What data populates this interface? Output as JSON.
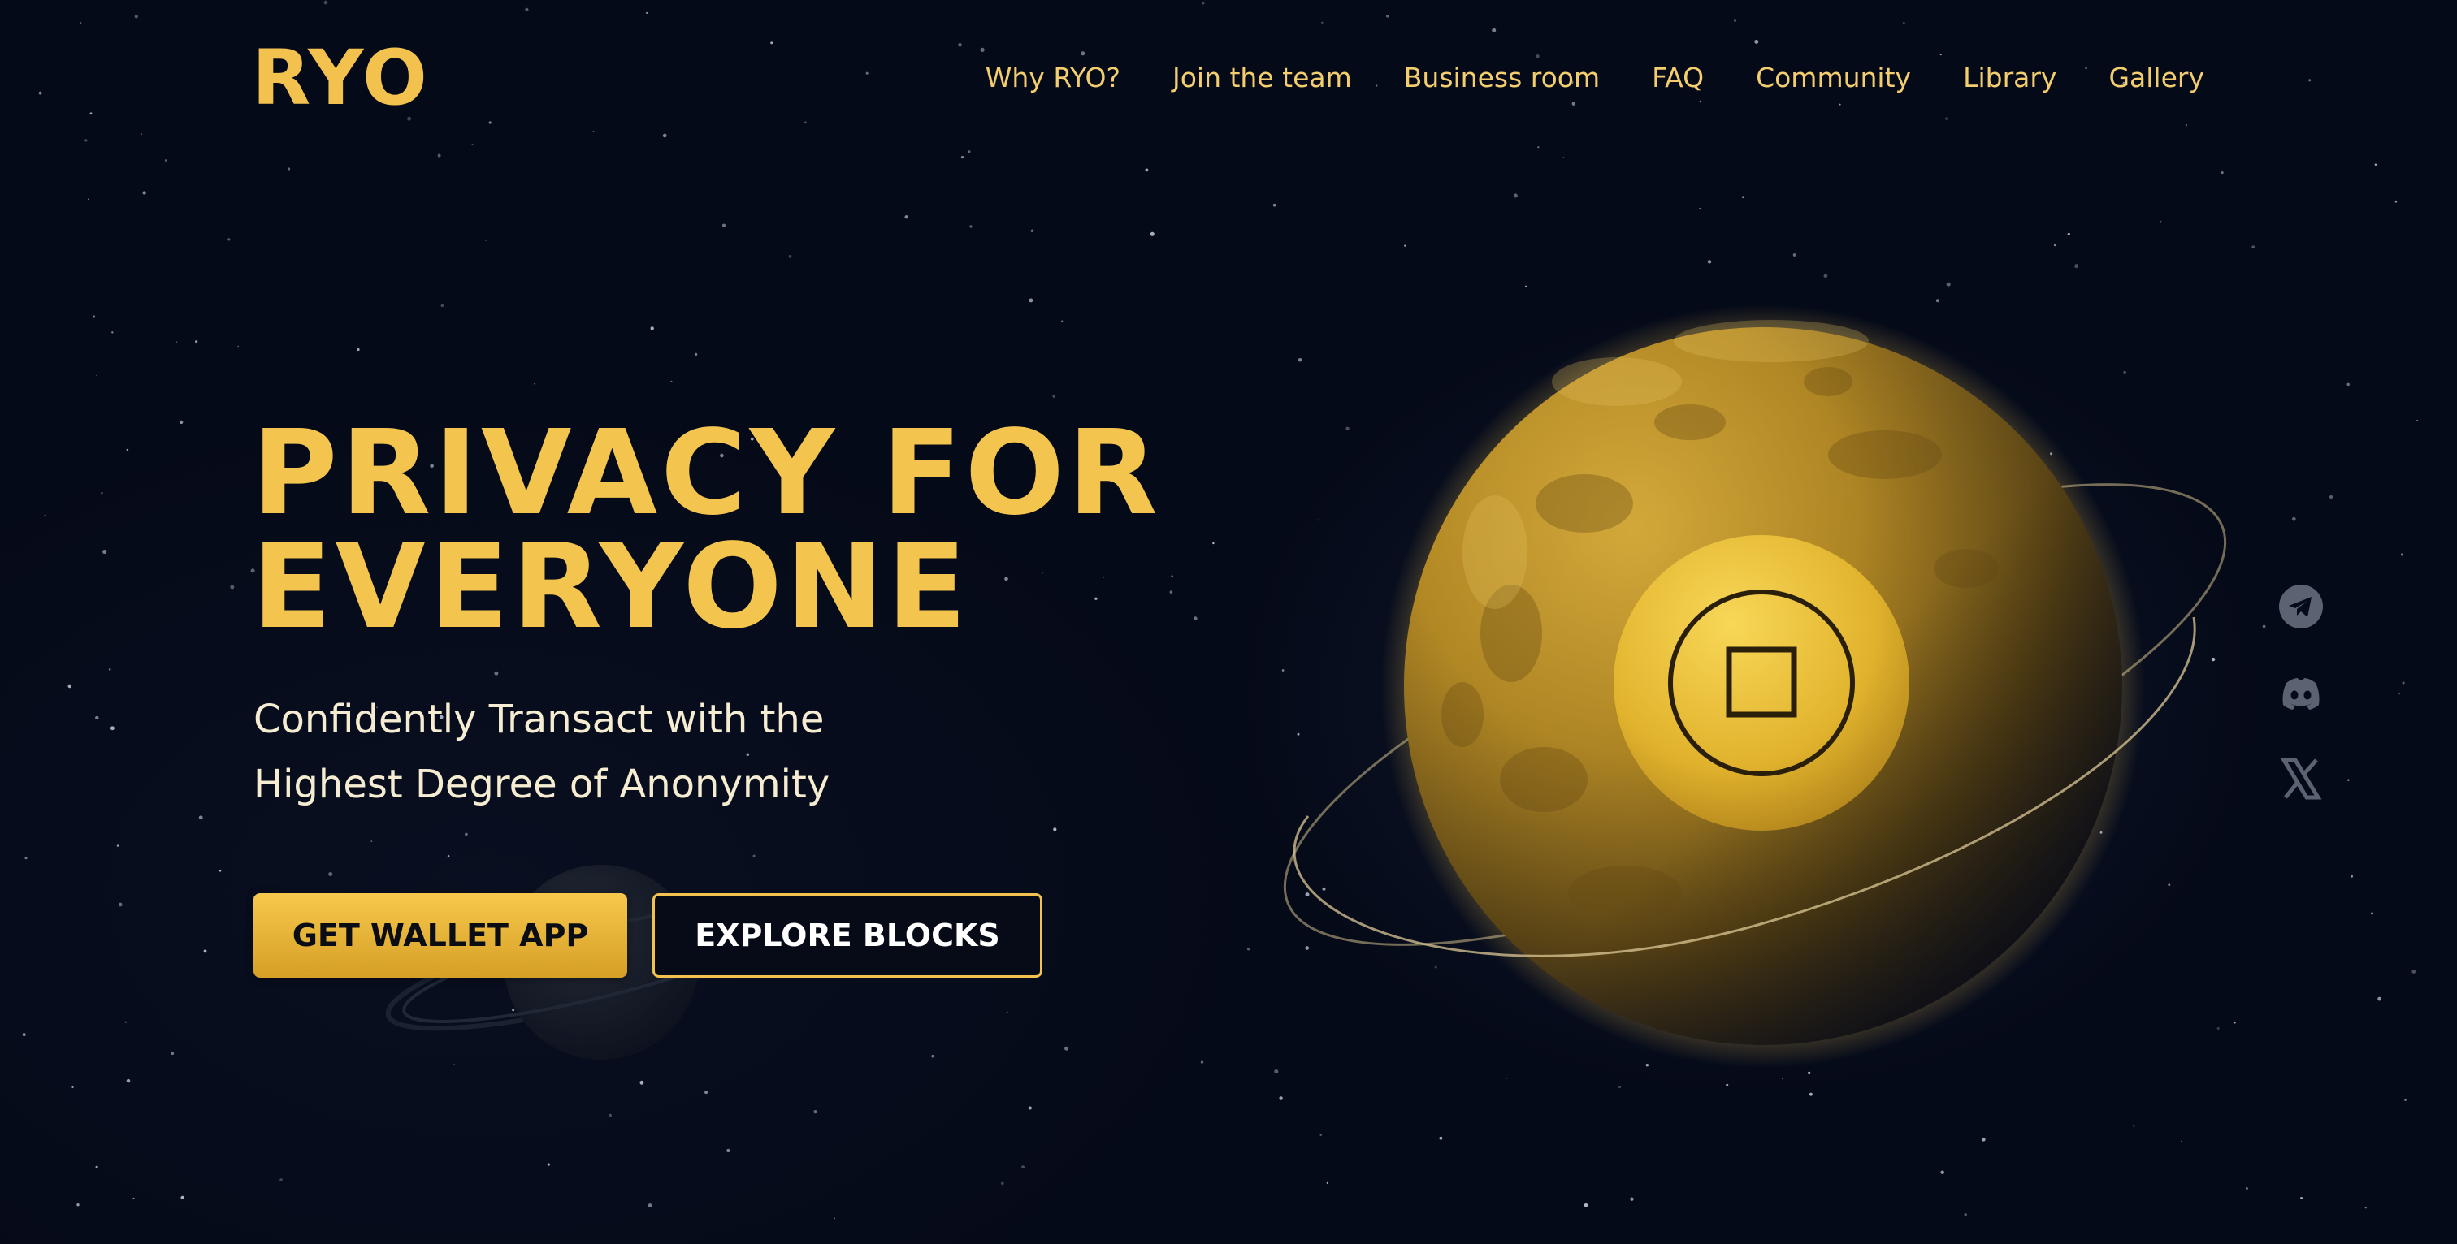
{
  "header": {
    "logo": "RYO",
    "nav": [
      {
        "label": "Why RYO?"
      },
      {
        "label": "Join the team"
      },
      {
        "label": "Business room"
      },
      {
        "label": "FAQ"
      },
      {
        "label": "Community"
      },
      {
        "label": "Library"
      },
      {
        "label": "Gallery"
      }
    ]
  },
  "hero": {
    "title_line1": "PRIVACY FOR",
    "title_line2": "EVERYONE",
    "subtitle_line1": "Confidently Transact with the",
    "subtitle_line2": "Highest Degree of Anonymity",
    "primary_button": "GET WALLET APP",
    "secondary_button": "EXPLORE BLOCKS"
  },
  "social": [
    {
      "icon": "telegram-icon"
    },
    {
      "icon": "discord-icon"
    },
    {
      "icon": "x-icon"
    }
  ],
  "colors": {
    "background": "#050a18",
    "accent": "#f2c14e",
    "nav_text": "#f3cd6e",
    "subtitle_text": "#f5ecd2",
    "social_icon": "#5b6372"
  }
}
